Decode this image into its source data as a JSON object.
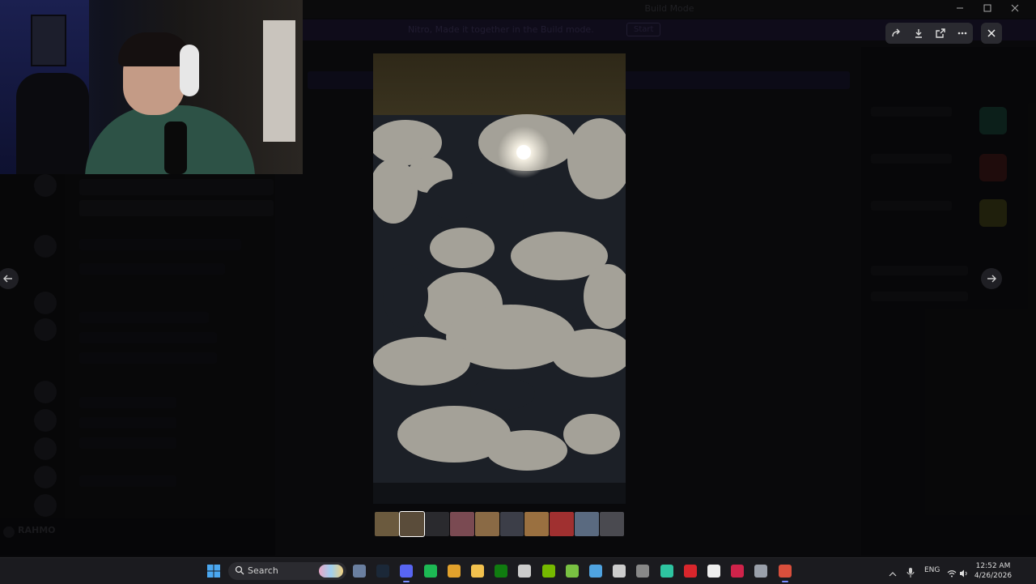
{
  "window": {
    "title": "Build Mode",
    "banner_text": "Nitro, Made it together in the Build mode.",
    "banner_button": "Start"
  },
  "viewer": {
    "toolbar": [
      "forward-icon",
      "download-icon",
      "open-in-new-icon",
      "more-icon"
    ],
    "close_icon": "close-icon",
    "prev_icon": "arrow-left-icon",
    "next_icon": "arrow-right-icon",
    "thumbnails": [
      {
        "color": "#6b5a3e"
      },
      {
        "color": "#5a4c3a"
      },
      {
        "color": "#2a2a2e"
      },
      {
        "color": "#7a4a52"
      },
      {
        "color": "#8a6a45"
      },
      {
        "color": "#3c3e48"
      },
      {
        "color": "#9a7040"
      },
      {
        "color": "#a03030"
      },
      {
        "color": "#5a6a80"
      },
      {
        "color": "#4a4a50"
      }
    ]
  },
  "sidebar": {
    "user_name": "RAHMO"
  },
  "taskbar": {
    "search_label": "Search",
    "tray_lang": "ENG",
    "time": "12:52 AM",
    "date": "4/26/2026",
    "apps": [
      {
        "name": "camera-app",
        "color": "#6a7fa0"
      },
      {
        "name": "steam-app",
        "color": "#1b2838"
      },
      {
        "name": "discord-app",
        "color": "#5865f2"
      },
      {
        "name": "spotify-app",
        "color": "#1db954"
      },
      {
        "name": "chrome-app",
        "color": "#e2a12c"
      },
      {
        "name": "files-app",
        "color": "#f2c14e"
      },
      {
        "name": "xbox-app",
        "color": "#107c10"
      },
      {
        "name": "store-app",
        "color": "#cccccc"
      },
      {
        "name": "nvidia-app",
        "color": "#76b900"
      },
      {
        "name": "play-app",
        "color": "#79c142"
      },
      {
        "name": "notes-app",
        "color": "#4fa3e0"
      },
      {
        "name": "g-app",
        "color": "#cccccc"
      },
      {
        "name": "battery-app",
        "color": "#888888"
      },
      {
        "name": "phone-app",
        "color": "#2ec4a0"
      },
      {
        "name": "wps-app",
        "color": "#d9262c"
      },
      {
        "name": "capcut-app",
        "color": "#eeeeee"
      },
      {
        "name": "adobe-app",
        "color": "#d0234a"
      },
      {
        "name": "settings-app",
        "color": "#9aa0aa"
      },
      {
        "name": "chrome2-app",
        "color": "#d94f3c"
      }
    ]
  },
  "colors": {
    "accent": "#5865f2",
    "taskbar_bg": "#1b1b1f"
  }
}
